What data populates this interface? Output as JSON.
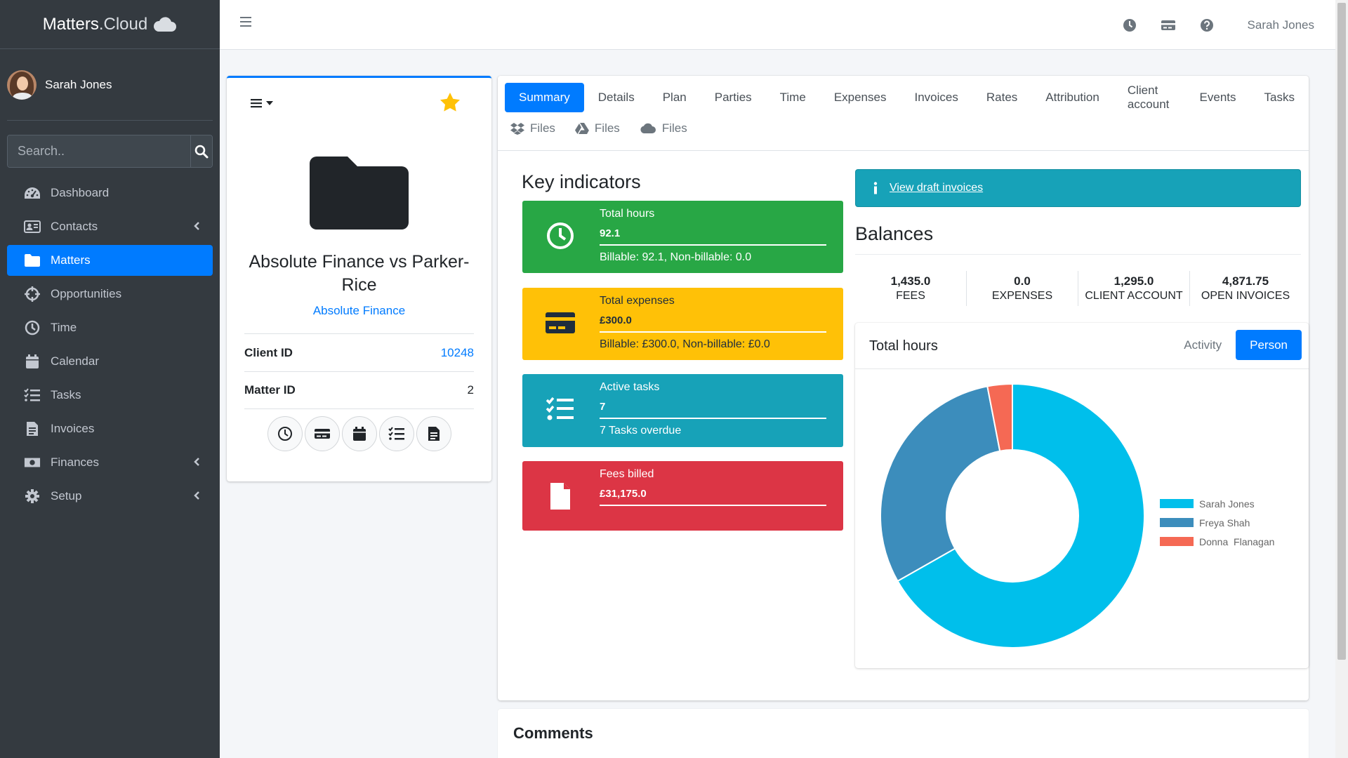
{
  "brand": {
    "name_a": "Matters",
    "name_b": ".Cloud",
    "icon": "cloud-icon"
  },
  "user": {
    "name": "Sarah Jones"
  },
  "search": {
    "placeholder": "Search.."
  },
  "sidebar": {
    "items": [
      {
        "label": "Dashboard",
        "icon": "dashboard-icon"
      },
      {
        "label": "Contacts",
        "icon": "contacts-icon",
        "expandable": true
      },
      {
        "label": "Matters",
        "icon": "folder-icon",
        "active": true
      },
      {
        "label": "Opportunities",
        "icon": "crosshairs-icon"
      },
      {
        "label": "Time",
        "icon": "clock-icon"
      },
      {
        "label": "Calendar",
        "icon": "calendar-icon"
      },
      {
        "label": "Tasks",
        "icon": "tasks-icon"
      },
      {
        "label": "Invoices",
        "icon": "invoice-icon"
      },
      {
        "label": "Finances",
        "icon": "money-icon",
        "expandable": true
      },
      {
        "label": "Setup",
        "icon": "gear-icon",
        "expandable": true
      }
    ]
  },
  "topbar": {
    "user_name": "Sarah Jones"
  },
  "matter": {
    "title": "Absolute Finance vs Parker-Rice",
    "client_name": "Absolute Finance",
    "client_id_label": "Client ID",
    "client_id": "10248",
    "matter_id_label": "Matter ID",
    "matter_id": "2"
  },
  "tabs": [
    {
      "label": "Summary",
      "active": true
    },
    {
      "label": "Details"
    },
    {
      "label": "Plan"
    },
    {
      "label": "Parties"
    },
    {
      "label": "Time"
    },
    {
      "label": "Expenses"
    },
    {
      "label": "Invoices"
    },
    {
      "label": "Rates"
    },
    {
      "label": "Attribution"
    },
    {
      "label": "Client account"
    },
    {
      "label": "Events"
    },
    {
      "label": "Tasks"
    }
  ],
  "file_tabs": [
    {
      "label": "Files",
      "icon": "dropbox-icon"
    },
    {
      "label": "Files",
      "icon": "google-drive-icon"
    },
    {
      "label": "Files",
      "icon": "cloud-icon"
    }
  ],
  "key_indicators": {
    "title": "Key indicators",
    "total_hours": {
      "label": "Total hours",
      "value": "92.1",
      "sub": "Billable: 92.1, Non-billable: 0.0",
      "color": "#28a745"
    },
    "total_expenses": {
      "label": "Total expenses",
      "value": "£300.0",
      "sub": "Billable: £300.0, Non-billable: £0.0",
      "color": "#ffc107"
    },
    "active_tasks": {
      "label": "Active tasks",
      "value": "7",
      "sub": "7 Tasks overdue",
      "color": "#17a2b8"
    },
    "fees_billed": {
      "label": "Fees billed",
      "value": "£31,175.0",
      "color": "#dc3545"
    }
  },
  "alert": {
    "link_text": "View draft invoices"
  },
  "balances": {
    "title": "Balances",
    "items": [
      {
        "value": "1,435.0",
        "label": "FEES"
      },
      {
        "value": "0.0",
        "label": "EXPENSES"
      },
      {
        "value": "1,295.0",
        "label": "CLIENT ACCOUNT"
      },
      {
        "value": "4,871.75",
        "label": "OPEN INVOICES"
      }
    ]
  },
  "total_hours_chart": {
    "title": "Total hours",
    "tabs": [
      {
        "label": "Activity"
      },
      {
        "label": "Person",
        "active": true
      }
    ]
  },
  "chart_data": {
    "type": "pie",
    "title": "",
    "categories": [
      "Sarah Jones",
      "Freya Shah",
      "Donna  Flanagan"
    ],
    "values": [
      61.5,
      27.8,
      2.8
    ],
    "colors": [
      "#00bfeb",
      "#3c8dbc",
      "#f56954"
    ],
    "donut": true,
    "legend": "right"
  },
  "comments": {
    "title": "Comments"
  }
}
